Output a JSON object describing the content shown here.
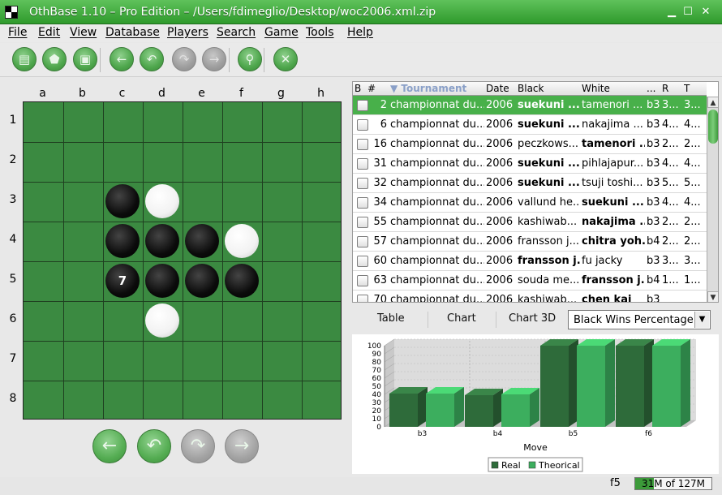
{
  "window": {
    "title": "OthBase 1.10 – Pro Edition – /Users/fdimeglio/Desktop/woc2006.xml.zip",
    "minimize": "▁",
    "maximize": "☐",
    "close": "✕"
  },
  "menu": [
    "File",
    "Edit",
    "View",
    "Database",
    "Players",
    "Search",
    "Game",
    "Tools",
    "Help"
  ],
  "toolbar": [
    {
      "icon": "new-icon",
      "glyph": "▤",
      "enabled": true
    },
    {
      "icon": "open-icon",
      "glyph": "⬟",
      "enabled": true
    },
    {
      "icon": "save-icon",
      "glyph": "▣",
      "enabled": true
    },
    {
      "icon": "back-icon",
      "glyph": "←",
      "enabled": true
    },
    {
      "icon": "undo-icon",
      "glyph": "↶",
      "enabled": true
    },
    {
      "icon": "redo-icon",
      "glyph": "↷",
      "enabled": false
    },
    {
      "icon": "forward-icon",
      "glyph": "→",
      "enabled": false
    },
    {
      "icon": "search-icon",
      "glyph": "⚲",
      "enabled": true
    },
    {
      "icon": "tools-icon",
      "glyph": "✕",
      "enabled": true
    }
  ],
  "board": {
    "columns": [
      "a",
      "b",
      "c",
      "d",
      "e",
      "f",
      "g",
      "h"
    ],
    "rows": [
      "1",
      "2",
      "3",
      "4",
      "5",
      "6",
      "7",
      "8"
    ],
    "discs": [
      {
        "square": "c3",
        "color": "black",
        "label": ""
      },
      {
        "square": "d3",
        "color": "white",
        "label": ""
      },
      {
        "square": "c4",
        "color": "black",
        "label": ""
      },
      {
        "square": "d4",
        "color": "black",
        "label": ""
      },
      {
        "square": "e4",
        "color": "black",
        "label": ""
      },
      {
        "square": "f4",
        "color": "white",
        "label": ""
      },
      {
        "square": "c5",
        "color": "black",
        "label": "7"
      },
      {
        "square": "d5",
        "color": "black",
        "label": ""
      },
      {
        "square": "e5",
        "color": "black",
        "label": ""
      },
      {
        "square": "f5",
        "color": "black",
        "label": ""
      },
      {
        "square": "d6",
        "color": "white",
        "label": ""
      }
    ]
  },
  "nav": [
    {
      "icon": "back-icon",
      "glyph": "←",
      "enabled": true
    },
    {
      "icon": "undo-icon",
      "glyph": "↶",
      "enabled": true
    },
    {
      "icon": "redo-icon",
      "glyph": "↷",
      "enabled": false
    },
    {
      "icon": "forward-icon",
      "glyph": "→",
      "enabled": false
    }
  ],
  "table": {
    "headers": [
      "B",
      "#",
      "▼ Tournament",
      "Date",
      "Black",
      "White",
      "...",
      "R",
      "T"
    ],
    "rows": [
      {
        "num": "2",
        "tournament": "championnat du...",
        "date": "2006",
        "black": "suekuni ...",
        "white": "tamenori ...",
        "opening": "b3",
        "r": "3...",
        "t": "3...",
        "bold": "black",
        "selected": true
      },
      {
        "num": "6",
        "tournament": "championnat du...",
        "date": "2006",
        "black": "suekuni ...",
        "white": "nakajima ...",
        "opening": "b3",
        "r": "4...",
        "t": "4...",
        "bold": "black",
        "selected": false
      },
      {
        "num": "16",
        "tournament": "championnat du...",
        "date": "2006",
        "black": "peczkows...",
        "white": "tamenori ...",
        "opening": "b3",
        "r": "2...",
        "t": "2...",
        "bold": "white",
        "selected": false
      },
      {
        "num": "31",
        "tournament": "championnat du...",
        "date": "2006",
        "black": "suekuni ...",
        "white": "pihlajapur...",
        "opening": "b3",
        "r": "4...",
        "t": "4...",
        "bold": "black",
        "selected": false
      },
      {
        "num": "32",
        "tournament": "championnat du...",
        "date": "2006",
        "black": "suekuni ...",
        "white": "tsuji toshi...",
        "opening": "b3",
        "r": "5...",
        "t": "5...",
        "bold": "black",
        "selected": false
      },
      {
        "num": "34",
        "tournament": "championnat du...",
        "date": "2006",
        "black": "vallund he...",
        "white": "suekuni ...",
        "opening": "b3",
        "r": "4...",
        "t": "4...",
        "bold": "white",
        "selected": false
      },
      {
        "num": "55",
        "tournament": "championnat du...",
        "date": "2006",
        "black": "kashiwab...",
        "white": "nakajima ...",
        "opening": "b3",
        "r": "2...",
        "t": "2...",
        "bold": "white",
        "selected": false
      },
      {
        "num": "57",
        "tournament": "championnat du...",
        "date": "2006",
        "black": "fransson j...",
        "white": "chitra yoh...",
        "opening": "b4",
        "r": "2...",
        "t": "2...",
        "bold": "white",
        "selected": false
      },
      {
        "num": "60",
        "tournament": "championnat du...",
        "date": "2006",
        "black": "fransson j...",
        "white": "fu jacky",
        "opening": "b3",
        "r": "3...",
        "t": "3...",
        "bold": "black",
        "selected": false
      },
      {
        "num": "63",
        "tournament": "championnat du...",
        "date": "2006",
        "black": "souda me...",
        "white": "fransson j...",
        "opening": "b4",
        "r": "1...",
        "t": "1...",
        "bold": "white",
        "selected": false
      },
      {
        "num": "70",
        "tournament": "championnat du...",
        "date": "2006",
        "black": "kashiwab...",
        "white": "chen kai",
        "opening": "b3",
        "r": "",
        "t": "",
        "bold": "white",
        "selected": false
      }
    ]
  },
  "view_tabs": [
    "Table",
    "Chart",
    "Chart 3D"
  ],
  "combo": {
    "value": "Black Wins Percentage"
  },
  "chart_data": {
    "type": "bar",
    "categories": [
      "b3",
      "b4",
      "b5",
      "f6"
    ],
    "series": [
      {
        "name": "Real",
        "values": [
          41,
          39,
          100,
          100
        ],
        "color": "#2e6b3a"
      },
      {
        "name": "Theorical",
        "values": [
          41,
          40,
          100,
          100
        ],
        "color": "#3cae5e"
      }
    ],
    "xlabel": "Move",
    "ylabel": "",
    "yticks": [
      0,
      10,
      20,
      30,
      40,
      50,
      60,
      70,
      80,
      90,
      100
    ],
    "ylim": [
      0,
      100
    ],
    "grid": true,
    "legend": "bottom"
  },
  "status": {
    "position": "f5",
    "memory_text": "31M of 127M",
    "memory_fraction": 0.244
  }
}
